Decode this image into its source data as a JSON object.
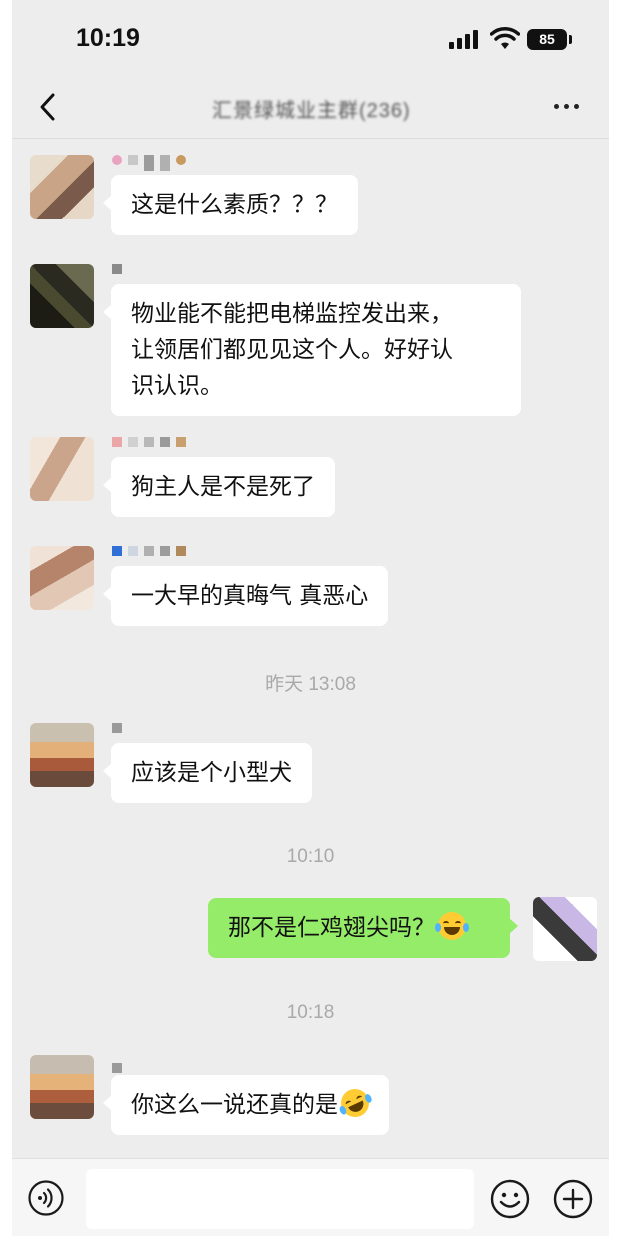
{
  "status_bar": {
    "time": "10:19",
    "battery": "85"
  },
  "header": {
    "title": "汇景绿城业主群(236)",
    "back_icon": "chevron-left-icon",
    "more_icon": "more-dots-icon"
  },
  "messages": [
    {
      "sender": "other",
      "text": "这是什么素质？？？"
    },
    {
      "sender": "other",
      "text": "物业能不能把电梯监控发出来，让领居们都见见这个人。好好认识认。"
    },
    {
      "sender": "other",
      "text": "狗主人是不是死了"
    },
    {
      "sender": "other",
      "text": "一大早的真晦气 真恶心"
    },
    {
      "type": "timestamp",
      "text": "昨天 13:08"
    },
    {
      "sender": "other",
      "text": "应该是个小型犬"
    },
    {
      "type": "timestamp",
      "text": "10:10"
    },
    {
      "sender": "me",
      "text": "那不是仁鸡翅尖吗？",
      "emoji": "laughing-tears-emoji"
    },
    {
      "type": "timestamp",
      "text": "10:18"
    },
    {
      "sender": "other",
      "text": "你这么一说还真的是",
      "emoji": "rolling-laugh-emoji"
    }
  ],
  "message_lines": {
    "m2_line1": "物业能不能把电梯监控发出来，",
    "m2_line2": "让领居们都见见这个人。好好认",
    "m2_line3": "识认识。"
  },
  "input_bar": {
    "voice_icon": "voice-icon",
    "emoji_icon": "smile-icon",
    "plus_icon": "plus-icon"
  },
  "colors": {
    "background": "#ededed",
    "bubble_other": "#ffffff",
    "bubble_me": "#95ec69",
    "timestamp": "#a9a9a9"
  }
}
